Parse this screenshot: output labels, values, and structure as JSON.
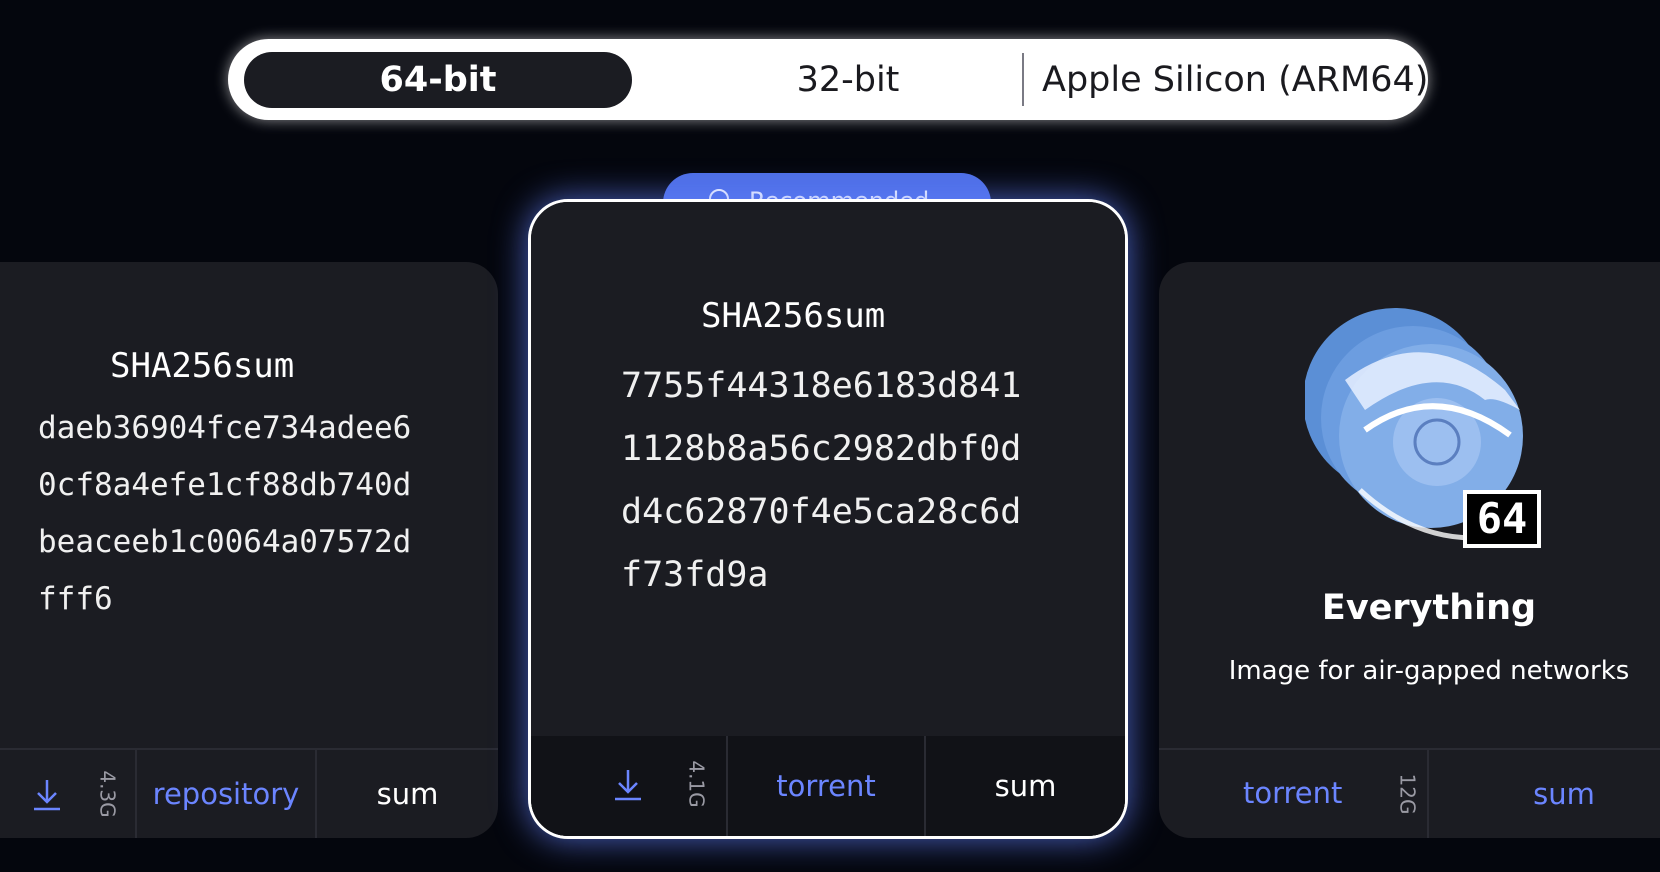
{
  "arch_tabs": {
    "tab_64": "64-bit",
    "tab_32": "32-bit",
    "tab_arm": "Apple Silicon (ARM64)"
  },
  "colors": {
    "accent": "#6b85ff",
    "badge": "#4e6fe6",
    "card_bg": "#1b1c22",
    "page_bg": "#04060d"
  },
  "left_card": {
    "hash_title": "SHA256sum",
    "hash_lines": [
      "daeb36904fce734adee6",
      "0cf8a4efe1cf88db740d",
      "beaceeb1c0064a07572d",
      "fff6"
    ],
    "download_icon": "download-icon",
    "size": "4.3G",
    "link_repository": "repository",
    "link_sum": "sum"
  },
  "center_card": {
    "badge_label": "Recommended",
    "badge_icon": "star-icon",
    "hash_title": "SHA256sum",
    "hash_lines": [
      "7755f44318e6183d841",
      "1128b8a56c2982dbf0d",
      "d4c62870f4e5ca28c6d",
      "f73fd9a"
    ],
    "download_icon": "download-icon",
    "size": "4.1G",
    "link_torrent": "torrent",
    "link_sum": "sum"
  },
  "right_card": {
    "logo_icon": "stacked-disc-dragon-icon",
    "logo_badge": "64",
    "title": "Everything",
    "subtitle": "Image for air-gapped networks",
    "link_torrent": "torrent",
    "size": "12G",
    "link_sum": "sum"
  }
}
